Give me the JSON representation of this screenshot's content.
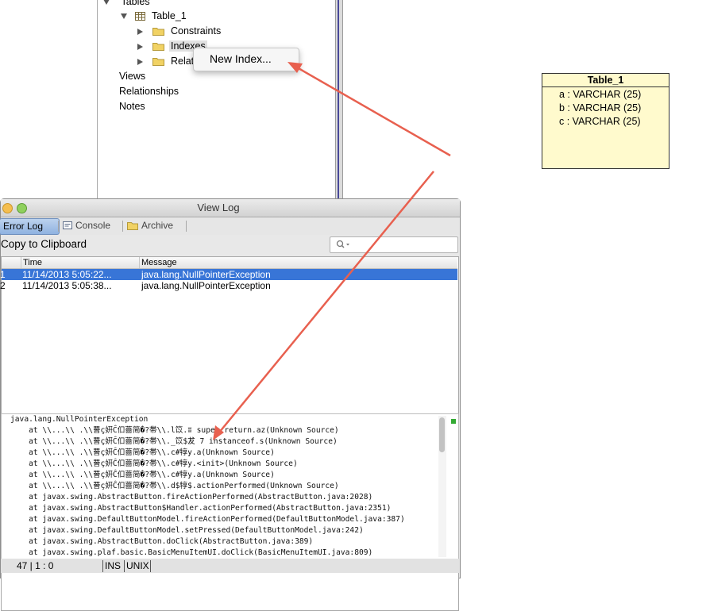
{
  "tree": {
    "root_label": "Tables",
    "table_label": "Table_1",
    "children": [
      "Constraints",
      "Indexes",
      "Relati"
    ],
    "sections": [
      "Views",
      "Relationships",
      "Notes"
    ]
  },
  "context_menu": {
    "item_label": "New Index..."
  },
  "entity": {
    "title": "Table_1",
    "fields": [
      "a : VARCHAR (25)",
      "b : VARCHAR (25)",
      "c : VARCHAR (25)"
    ]
  },
  "log_window": {
    "title": "View Log",
    "tabs": [
      "Error Log",
      "Console",
      "Archive"
    ],
    "copy_button": "Copy to Clipboard",
    "search_placeholder": "",
    "columns": [
      "",
      "Time",
      "Message"
    ],
    "rows": [
      {
        "num": "1",
        "time": "11/14/2013 5:05:22...",
        "message": "java.lang.NullPointerException"
      },
      {
        "num": "2",
        "time": "11/14/2013 5:05:38...",
        "message": "java.lang.NullPointerException"
      }
    ],
    "trace": [
      "java.lang.NullPointerException",
      "    at \\\\...\\\\ .\\\\罾ç姸Ĉ㐰蔷简�?帯\\\\.l笖.ʬ super return.az(Unknown Source)",
      "    at \\\\...\\\\ .\\\\罾ç姸Ĉ㐰蔷简�?帯\\\\._笖$犮 7 instanceof.s(Unknown Source)",
      "    at \\\\...\\\\ .\\\\罾ç姸Ĉ㐰蔷简�?帯\\\\.c#犉y.a(Unknown Source)",
      "    at \\\\...\\\\ .\\\\罾ç姸Ĉ㐰蔷简�?帯\\\\.c#犉y.<init>(Unknown Source)",
      "    at \\\\...\\\\ .\\\\罾ç姸Ĉ㐰蔷简�?帯\\\\.c#犉y.a(Unknown Source)",
      "    at \\\\...\\\\ .\\\\罾ç姸Ĉ㐰蔷简�?帯\\\\.d$犉$.actionPerformed(Unknown Source)",
      "    at javax.swing.AbstractButton.fireActionPerformed(AbstractButton.java:2028)",
      "    at javax.swing.AbstractButton$Handler.actionPerformed(AbstractButton.java:2351)",
      "    at javax.swing.DefaultButtonModel.fireActionPerformed(DefaultButtonModel.java:387)",
      "    at javax.swing.DefaultButtonModel.setPressed(DefaultButtonModel.java:242)",
      "    at javax.swing.AbstractButton.doClick(AbstractButton.java:389)",
      "    at javax.swing.plaf.basic.BasicMenuItemUI.doClick(BasicMenuItemUI.java:809)"
    ],
    "status": {
      "position": "47 | 1 : 0",
      "mode": "INS",
      "encoding": "UNIX"
    }
  },
  "colors": {
    "selection": "#3875d7",
    "annotation_arrow": "#e8604f",
    "entity_fill": "#fffacd",
    "folder": "#f1d264"
  },
  "icons": [
    "folder-icon",
    "table-grid-icon",
    "search-icon",
    "console-icon",
    "archive-folder-icon"
  ]
}
